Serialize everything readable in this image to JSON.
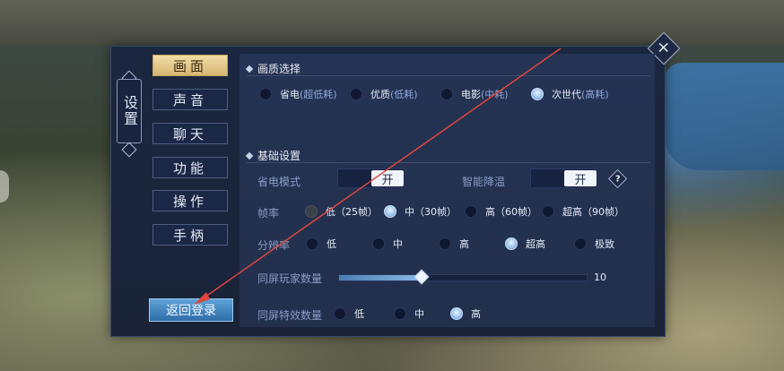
{
  "side_tag": "设置",
  "close_glyph": "×",
  "tabs": [
    {
      "label": "画面",
      "active": true
    },
    {
      "label": "声音",
      "active": false
    },
    {
      "label": "聊天",
      "active": false
    },
    {
      "label": "功能",
      "active": false
    },
    {
      "label": "操作",
      "active": false
    },
    {
      "label": "手柄",
      "active": false
    }
  ],
  "back_button": "返回登录",
  "quality": {
    "title": "画质选择",
    "options": [
      {
        "name": "省电",
        "note": "(超低耗)",
        "selected": false
      },
      {
        "name": "优质",
        "note": "(低耗)",
        "selected": false
      },
      {
        "name": "电影",
        "note": "(中耗)",
        "selected": false
      },
      {
        "name": "次世代",
        "note": "(高耗)",
        "selected": true
      }
    ]
  },
  "basic": {
    "title": "基础设置",
    "power_save": {
      "label": "省电模式",
      "value": "开"
    },
    "smart_cool": {
      "label": "智能降温",
      "value": "开"
    },
    "help_glyph": "?",
    "frame_rate": {
      "label": "帧率",
      "options": [
        {
          "text": "低（25帧）",
          "selected": false,
          "disabled": true
        },
        {
          "text": "中（30帧）",
          "selected": true,
          "disabled": false
        },
        {
          "text": "高（60帧）",
          "selected": false,
          "disabled": false
        },
        {
          "text": "超高（90帧）",
          "selected": false,
          "disabled": false
        }
      ]
    },
    "resolution": {
      "label": "分辨率",
      "options": [
        {
          "text": "低",
          "selected": false
        },
        {
          "text": "中",
          "selected": false
        },
        {
          "text": "高",
          "selected": false
        },
        {
          "text": "超高",
          "selected": true
        },
        {
          "text": "极致",
          "selected": false
        }
      ]
    },
    "players_on_screen": {
      "label": "同屏玩家数量",
      "value": "10",
      "fill_fraction": 0.33
    },
    "effects_on_screen": {
      "label": "同屏特效数量",
      "options": [
        {
          "text": "低",
          "selected": false
        },
        {
          "text": "中",
          "selected": false
        },
        {
          "text": "高",
          "selected": true
        }
      ]
    }
  },
  "colors": {
    "accent_gold": "#d7b674",
    "accent_blue": "#5fa1d8",
    "arrow": "#e0463c"
  }
}
